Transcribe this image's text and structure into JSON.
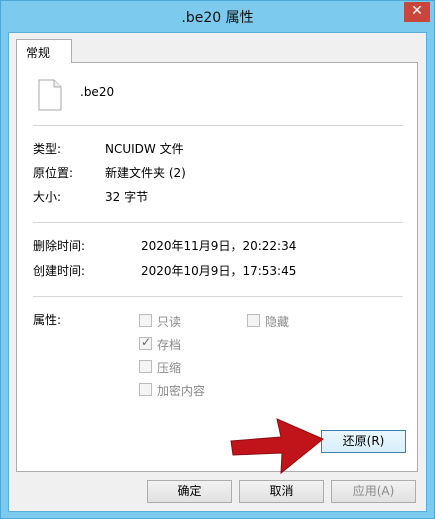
{
  "window": {
    "title": ".be20 属性",
    "close_glyph": "✕"
  },
  "tabs": [
    {
      "label": "常规"
    }
  ],
  "file": {
    "name": ".be20",
    "icon": "blank-file-icon"
  },
  "info": [
    {
      "label": "类型:",
      "value": "NCUIDW 文件"
    },
    {
      "label": "原位置:",
      "value": "新建文件夹 (2)"
    },
    {
      "label": "大小:",
      "value": "32 字节"
    }
  ],
  "times": [
    {
      "label": "删除时间:",
      "value": "2020年11月9日，20:22:34"
    },
    {
      "label": "创建时间:",
      "value": "2020年10月9日，17:53:45"
    }
  ],
  "attributes": {
    "label": "属性:",
    "items": [
      {
        "label": "只读",
        "checked": false
      },
      {
        "label": "隐藏",
        "checked": false
      },
      {
        "label": "存档",
        "checked": true
      },
      {
        "label": "压缩",
        "checked": false
      },
      {
        "label": "加密内容",
        "checked": false
      }
    ]
  },
  "buttons": {
    "restore": "还原(R)",
    "ok": "确定",
    "cancel": "取消",
    "apply": "应用(A)"
  },
  "colors": {
    "arrow": "#c0141a",
    "titlebar": "#7ccaed",
    "close": "#c9463d"
  }
}
